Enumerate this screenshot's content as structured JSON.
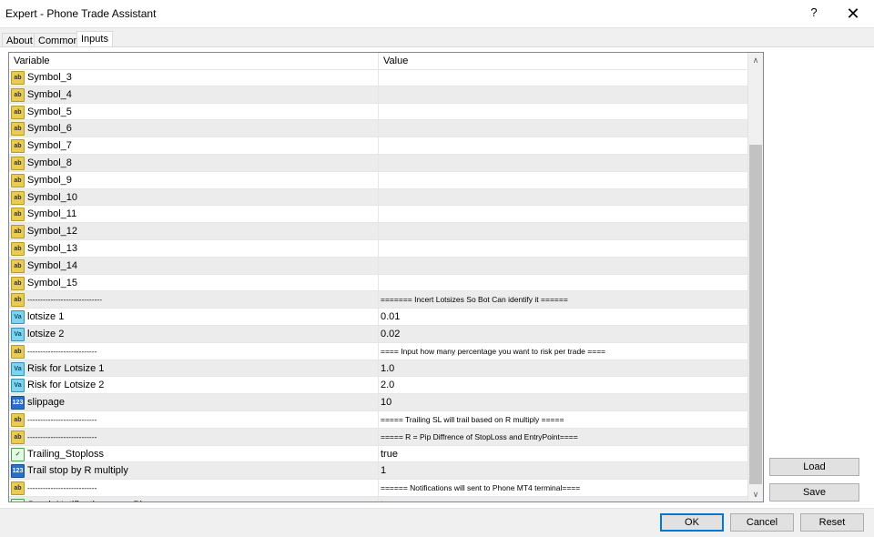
{
  "window": {
    "title": "Expert - Phone Trade Assistant",
    "help_glyph": "?",
    "close_glyph": "✕"
  },
  "tabs": [
    {
      "label": "About",
      "active": false
    },
    {
      "label": "Common",
      "active": false
    },
    {
      "label": "Inputs",
      "active": true
    }
  ],
  "grid": {
    "header_variable": "Variable",
    "header_value": "Value",
    "rows": [
      {
        "icon": "ab",
        "name": "Symbol_3",
        "value": ""
      },
      {
        "icon": "ab",
        "name": "Symbol_4",
        "value": ""
      },
      {
        "icon": "ab",
        "name": "Symbol_5",
        "value": ""
      },
      {
        "icon": "ab",
        "name": "Symbol_6",
        "value": ""
      },
      {
        "icon": "ab",
        "name": "Symbol_7",
        "value": ""
      },
      {
        "icon": "ab",
        "name": "Symbol_8",
        "value": ""
      },
      {
        "icon": "ab",
        "name": "Symbol_9",
        "value": ""
      },
      {
        "icon": "ab",
        "name": "Symbol_10",
        "value": ""
      },
      {
        "icon": "ab",
        "name": "Symbol_11",
        "value": ""
      },
      {
        "icon": "ab",
        "name": "Symbol_12",
        "value": ""
      },
      {
        "icon": "ab",
        "name": "Symbol_13",
        "value": ""
      },
      {
        "icon": "ab",
        "name": "Symbol_14",
        "value": ""
      },
      {
        "icon": "ab",
        "name": "Symbol_15",
        "value": ""
      },
      {
        "icon": "ab",
        "name": "-----------------------------",
        "value": "======= Incert Lotsizes So Bot Can identify it ======",
        "sep": true
      },
      {
        "icon": "val",
        "name": "lotsize 1",
        "value": "0.01"
      },
      {
        "icon": "val",
        "name": "lotsize 2",
        "value": "0.02"
      },
      {
        "icon": "ab",
        "name": "---------------------------",
        "value": "==== Input how many percentage you want to risk per trade ====",
        "sep": true
      },
      {
        "icon": "val",
        "name": "Risk for Lotsize 1",
        "value": "1.0"
      },
      {
        "icon": "val",
        "name": "Risk for Lotsize 2",
        "value": "2.0"
      },
      {
        "icon": "num",
        "name": "slippage",
        "value": "10"
      },
      {
        "icon": "ab",
        "name": "---------------------------",
        "value": "===== Trailing SL will trail based on R multiply =====",
        "sep": true
      },
      {
        "icon": "ab",
        "name": "---------------------------",
        "value": "===== R = Pip Diffrence of StopLoss and EntryPoint====",
        "sep": true
      },
      {
        "icon": "bool",
        "name": "Trailing_Stoploss",
        "value": "true"
      },
      {
        "icon": "num",
        "name": "Trail stop by R multiply",
        "value": "1"
      },
      {
        "icon": "ab",
        "name": "---------------------------",
        "value": "====== Notifications will sent to Phone MT4 terminal====",
        "sep": true
      },
      {
        "icon": "bool",
        "name": "Send_Notifications_on_Phone",
        "value": "true"
      }
    ]
  },
  "icon_glyphs": {
    "ab": "ab",
    "val": "Va",
    "num": "123",
    "bool": "✓"
  },
  "scrollbar": {
    "up_glyph": "∧",
    "down_glyph": "∨"
  },
  "buttons": {
    "load": "Load",
    "save": "Save",
    "ok": "OK",
    "cancel": "Cancel",
    "reset": "Reset"
  }
}
